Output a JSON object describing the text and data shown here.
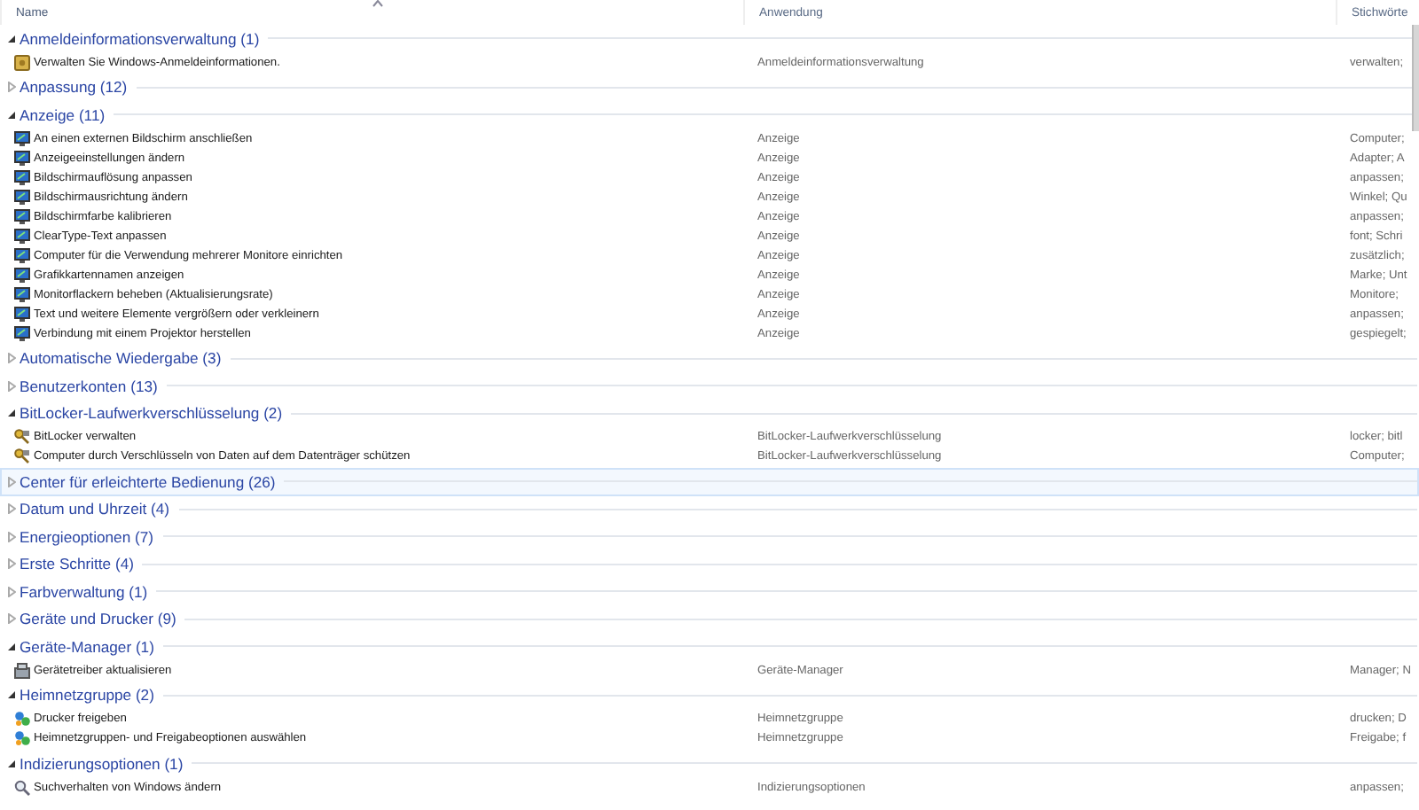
{
  "columns": [
    {
      "label": "Name",
      "sorted": true
    },
    {
      "label": "Anwendung",
      "sorted": false
    },
    {
      "label": "Stichwörte",
      "sorted": false
    }
  ],
  "groups": [
    {
      "title": "Anmeldeinformationsverwaltung (1)",
      "expanded": true,
      "selected": false,
      "items": [
        {
          "kind": "credential",
          "name": "Verwalten Sie Windows-Anmeldeinformationen.",
          "app": "Anmeldeinformationsverwaltung",
          "keywords": "verwalten;"
        }
      ]
    },
    {
      "title": "Anpassung (12)",
      "expanded": false,
      "selected": false
    },
    {
      "title": "Anzeige (11)",
      "expanded": true,
      "selected": false,
      "items": [
        {
          "kind": "monitor",
          "name": "An einen externen Bildschirm anschließen",
          "app": "Anzeige",
          "keywords": "Computer;"
        },
        {
          "kind": "monitor",
          "name": "Anzeigeeinstellungen ändern",
          "app": "Anzeige",
          "keywords": "Adapter; A"
        },
        {
          "kind": "monitor",
          "name": "Bildschirmauflösung anpassen",
          "app": "Anzeige",
          "keywords": "anpassen;"
        },
        {
          "kind": "monitor",
          "name": "Bildschirmausrichtung ändern",
          "app": "Anzeige",
          "keywords": "Winkel; Qu"
        },
        {
          "kind": "monitor",
          "name": "Bildschirmfarbe kalibrieren",
          "app": "Anzeige",
          "keywords": "anpassen;"
        },
        {
          "kind": "monitor",
          "name": "ClearType-Text anpassen",
          "app": "Anzeige",
          "keywords": "font; Schri"
        },
        {
          "kind": "monitor",
          "name": "Computer für die Verwendung mehrerer Monitore einrichten",
          "app": "Anzeige",
          "keywords": "zusätzlich;"
        },
        {
          "kind": "monitor",
          "name": "Grafikkartennamen anzeigen",
          "app": "Anzeige",
          "keywords": "Marke; Unt"
        },
        {
          "kind": "monitor",
          "name": "Monitorflackern beheben (Aktualisierungsrate)",
          "app": "Anzeige",
          "keywords": "Monitore;"
        },
        {
          "kind": "monitor",
          "name": "Text und weitere Elemente vergrößern oder verkleinern",
          "app": "Anzeige",
          "keywords": "anpassen;"
        },
        {
          "kind": "monitor",
          "name": "Verbindung mit einem Projektor herstellen",
          "app": "Anzeige",
          "keywords": "gespiegelt;"
        }
      ]
    },
    {
      "title": "Automatische Wiedergabe (3)",
      "expanded": false,
      "selected": false
    },
    {
      "title": "Benutzerkonten (13)",
      "expanded": false,
      "selected": false
    },
    {
      "title": "BitLocker-Laufwerkverschlüsselung (2)",
      "expanded": true,
      "selected": false,
      "items": [
        {
          "kind": "keys",
          "name": "BitLocker verwalten",
          "app": "BitLocker-Laufwerkverschlüsselung",
          "keywords": "locker; bitl"
        },
        {
          "kind": "keys",
          "name": "Computer durch Verschlüsseln von Daten auf dem Datenträger schützen",
          "app": "BitLocker-Laufwerkverschlüsselung",
          "keywords": "Computer;"
        }
      ]
    },
    {
      "title": "Center für erleichterte Bedienung (26)",
      "expanded": false,
      "selected": true
    },
    {
      "title": "Datum und Uhrzeit (4)",
      "expanded": false,
      "selected": false
    },
    {
      "title": "Energieoptionen (7)",
      "expanded": false,
      "selected": false
    },
    {
      "title": "Erste Schritte (4)",
      "expanded": false,
      "selected": false
    },
    {
      "title": "Farbverwaltung (1)",
      "expanded": false,
      "selected": false
    },
    {
      "title": "Geräte und Drucker (9)",
      "expanded": false,
      "selected": false
    },
    {
      "title": "Geräte-Manager (1)",
      "expanded": true,
      "selected": false,
      "items": [
        {
          "kind": "device",
          "name": "Gerätetreiber aktualisieren",
          "app": "Geräte-Manager",
          "keywords": "Manager; N"
        }
      ]
    },
    {
      "title": "Heimnetzgruppe (2)",
      "expanded": true,
      "selected": false,
      "items": [
        {
          "kind": "network",
          "name": "Drucker freigeben",
          "app": "Heimnetzgruppe",
          "keywords": "drucken; D"
        },
        {
          "kind": "network",
          "name": "Heimnetzgruppen- und Freigabeoptionen auswählen",
          "app": "Heimnetzgruppe",
          "keywords": "Freigabe; f"
        }
      ]
    },
    {
      "title": "Indizierungsoptionen (1)",
      "expanded": true,
      "selected": false,
      "items": [
        {
          "kind": "search",
          "name": "Suchverhalten von Windows ändern",
          "app": "Indizierungsoptionen",
          "keywords": "anpassen;"
        }
      ]
    }
  ]
}
